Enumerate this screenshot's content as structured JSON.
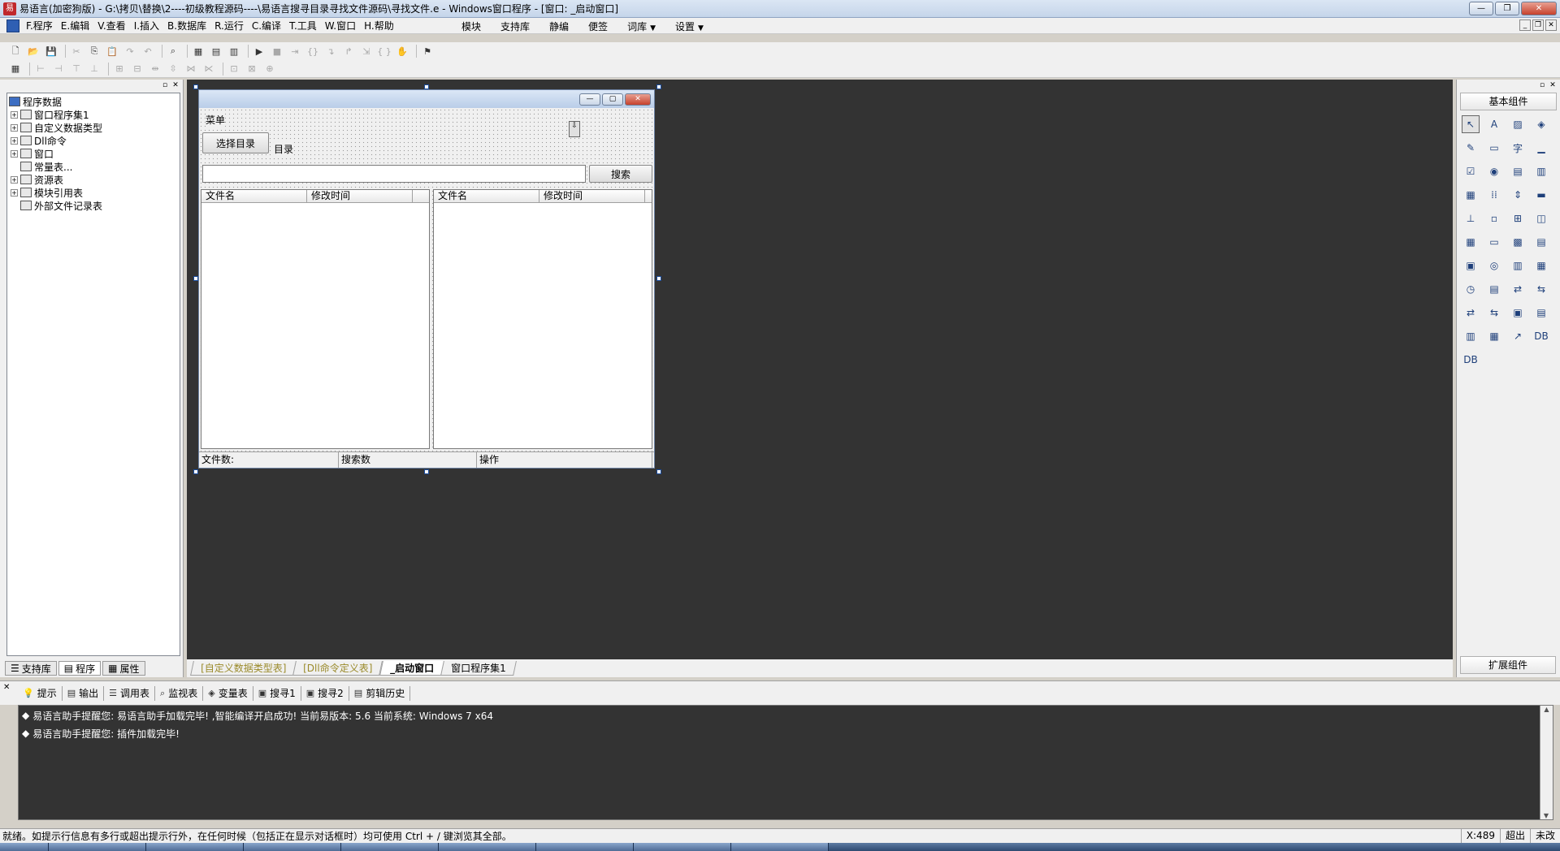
{
  "titlebar": {
    "title": "易语言(加密狗版) - G:\\拷贝\\替换\\2----初级教程源码----\\易语言搜寻目录寻找文件源码\\寻找文件.e - Windows窗口程序 - [窗口: _启动窗口]",
    "minimize": "—",
    "restore": "❐",
    "close": "✕"
  },
  "menubar": {
    "items": [
      "F.程序",
      "E.编辑",
      "V.查看",
      "I.插入",
      "B.数据库",
      "R.运行",
      "C.编译",
      "T.工具",
      "W.窗口",
      "H.帮助"
    ],
    "right_items": [
      "模块",
      "支持库",
      "静编",
      "便签",
      "词库",
      "设置"
    ],
    "mdi_min": "_",
    "mdi_restore": "❐",
    "mdi_close": "✕"
  },
  "left_panel": {
    "tree": [
      {
        "label": "程序数据",
        "level": 0,
        "expander": ""
      },
      {
        "label": "窗口程序集1",
        "level": 1,
        "expander": "+"
      },
      {
        "label": "自定义数据类型",
        "level": 1,
        "expander": "+"
      },
      {
        "label": "Dll命令",
        "level": 1,
        "expander": "+"
      },
      {
        "label": "窗口",
        "level": 1,
        "expander": "+"
      },
      {
        "label": "常量表...",
        "level": 1,
        "expander": ""
      },
      {
        "label": "资源表",
        "level": 1,
        "expander": "+"
      },
      {
        "label": "模块引用表",
        "level": 1,
        "expander": "+"
      },
      {
        "label": "外部文件记录表",
        "level": 1,
        "expander": ""
      }
    ],
    "tabs": [
      "支持库",
      "程序",
      "属性"
    ]
  },
  "form": {
    "menu_label": "菜单",
    "select_button": "选择目录",
    "dir_label": "目录",
    "path_value": "",
    "search_button": "搜索",
    "left_list_columns": [
      "文件名",
      "修改时间"
    ],
    "right_list_columns": [
      "文件名",
      "修改时间"
    ],
    "status_cells": [
      "文件数:",
      "搜索数",
      "操作"
    ]
  },
  "doc_tabs": [
    "[自定义数据类型表]",
    "[Dll命令定义表]",
    "_启动窗口",
    "窗口程序集1"
  ],
  "right_panel": {
    "title": "基本组件",
    "extension": "扩展组件",
    "component_icons": [
      "↖",
      "A",
      "▨",
      "◈",
      "✎",
      "▭",
      "字",
      "▁",
      "☑",
      "◉",
      "▤",
      "▥",
      "▦",
      "⁞⁞",
      "⇕",
      "▬",
      "⊥",
      "▫",
      "⊞",
      "◫",
      "▦",
      "▭",
      "▩",
      "▤",
      "▣",
      "◎",
      "▥",
      "▦",
      "◷",
      "▤",
      "⇄",
      "⇆",
      "⇄",
      "⇆",
      "▣",
      "▤",
      "▥",
      "▦",
      "↗",
      "DB",
      "DB"
    ]
  },
  "output": {
    "tabs": [
      "提示",
      "输出",
      "调用表",
      "监视表",
      "变量表",
      "搜寻1",
      "搜寻2",
      "剪辑历史"
    ],
    "lines": [
      "易语言助手提醒您: 易语言助手加载完毕! ,智能编译开启成功! 当前易版本: 5.6 当前系统: Windows 7 x64",
      "易语言助手提醒您: 插件加载完毕!"
    ]
  },
  "statusbar": {
    "text": "就绪。如提示行信息有多行或超出提示行外，在任何时候（包括正在显示对话框时）均可使用 Ctrl + / 键浏览其全部。",
    "coord": "X:489",
    "mode": "超出",
    "extra": "未改"
  }
}
